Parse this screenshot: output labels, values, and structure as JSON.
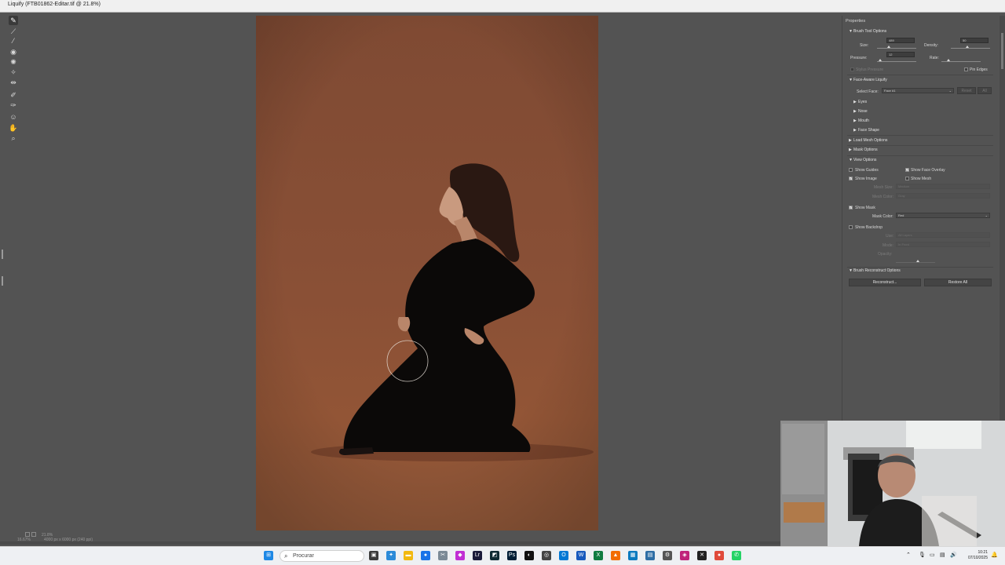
{
  "window": {
    "title": "Liquify (FTB01862-Editar.tif @ 21.8%)"
  },
  "tools": [
    "forward-warp-icon",
    "reconstruct-icon",
    "smooth-icon",
    "twirl-icon",
    "pucker-icon",
    "bloat-icon",
    "push-left-icon",
    "freeze-mask-icon",
    "thaw-mask-icon",
    "face-tool-icon",
    "hand-icon",
    "zoom-icon"
  ],
  "status": {
    "zoom": "21.8%",
    "zoom_field": "16.67%",
    "doc_info": "4000 px x 6000 px (240 ppi)"
  },
  "panel": {
    "title": "Properties",
    "brush_tool_options": {
      "header": "Brush Tool Options",
      "size_label": "Size:",
      "size_value": "489",
      "density_label": "Density:",
      "density_value": "50",
      "pressure_label": "Pressure:",
      "pressure_value": "12",
      "rate_label": "Rate:",
      "stylus_pressure": "Stylus Pressure",
      "pin_edges": "Pin Edges"
    },
    "face_aware": {
      "header": "Face-Aware Liquify",
      "select_face_label": "Select Face:",
      "select_face_value": "Face #1",
      "reset": "Reset",
      "all": "All",
      "eyes": "Eyes",
      "nose": "Nose",
      "mouth": "Mouth",
      "face_shape": "Face Shape"
    },
    "load_mesh": "Load Mesh Options",
    "mask_options": "Mask Options",
    "view_options": {
      "header": "View Options",
      "show_guides": "Show Guides",
      "show_face_overlay": "Show Face Overlay",
      "show_image": "Show Image",
      "show_mesh": "Show Mesh",
      "mesh_size_label": "Mesh Size:",
      "mesh_size_value": "Medium",
      "mesh_color_label": "Mesh Color:",
      "mesh_color_value": "Gray",
      "show_mask": "Show Mask",
      "mask_color_label": "Mask Color:",
      "mask_color_value": "Red",
      "show_backdrop": "Show Backdrop",
      "use_label": "Use:",
      "use_value": "All Layers",
      "mode_label": "Mode:",
      "mode_value": "In Front",
      "opacity_label": "Opacity:"
    },
    "brush_reconstruct": {
      "header": "Brush Reconstruct Options",
      "reconstruct": "Reconstruct...",
      "restore_all": "Restore All"
    }
  },
  "taskbar": {
    "search_placeholder": "Procurar",
    "time": "10:21",
    "date": "07/10/2025"
  },
  "colors": {
    "background_canvas": "#8a5036",
    "panel": "#535353",
    "taskbar": "#eef0f3"
  }
}
